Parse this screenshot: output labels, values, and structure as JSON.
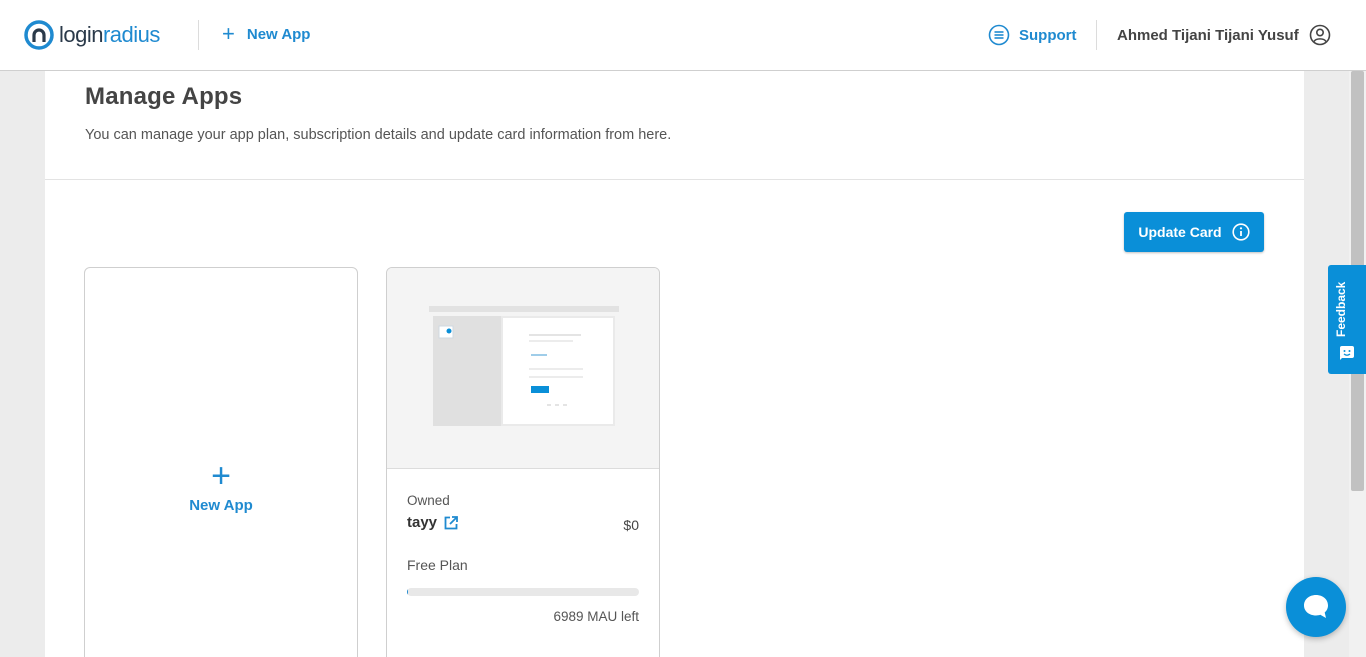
{
  "header": {
    "logo_text_a": "login",
    "logo_text_b": "radius",
    "new_app_label": "New App",
    "support_label": "Support",
    "user_name": "Ahmed Tijani Tijani Yusuf"
  },
  "page": {
    "title": "Manage Apps",
    "subtitle": "You can manage your app plan, subscription details and update card information from here.",
    "update_card_label": "Update Card"
  },
  "cards": {
    "new_app_label": "New App",
    "app": {
      "ownership": "Owned",
      "name": "tayy",
      "price": "$0",
      "plan": "Free Plan",
      "usage_fraction": 0.003,
      "mau_left": "6989 MAU left"
    }
  },
  "widgets": {
    "feedback_label": "Feedback"
  },
  "colors": {
    "accent": "#0a8fd8",
    "link": "#1f8ad0"
  }
}
